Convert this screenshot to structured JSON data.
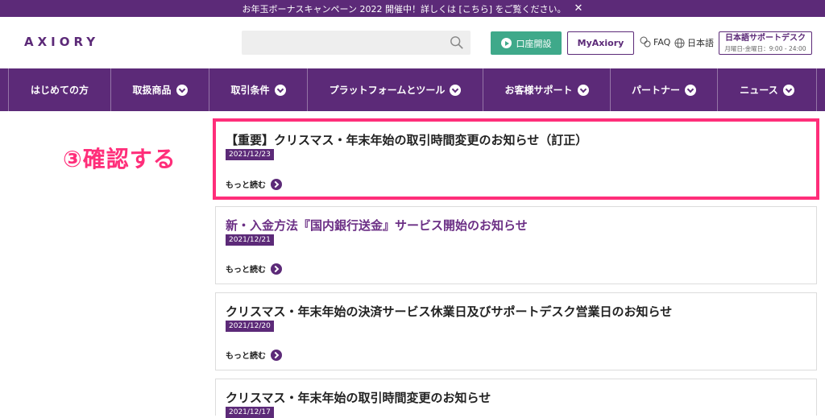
{
  "banner": {
    "text": "お年玉ボーナスキャンペーン 2022 開催中！詳しくは [こちら] をご覧ください。",
    "close": "✕"
  },
  "header": {
    "logo": "AXIORY",
    "search_placeholder": "",
    "open_account": "口座開設",
    "my_axiory": "MyAxiory",
    "faq": "FAQ",
    "language": "日本語",
    "support_title": "日本語サポートデスク",
    "support_hours": "月曜日-金曜日：9:00 - 24:00"
  },
  "nav": [
    {
      "label": "はじめての方",
      "chevron": false
    },
    {
      "label": "取扱商品",
      "chevron": true
    },
    {
      "label": "取引条件",
      "chevron": true
    },
    {
      "label": "プラットフォームとツール",
      "chevron": true
    },
    {
      "label": "お客様サポート",
      "chevron": true
    },
    {
      "label": "パートナー",
      "chevron": true
    },
    {
      "label": "ニュース",
      "chevron": true
    }
  ],
  "annotation": "③確認する",
  "news": [
    {
      "title": "【重要】クリスマス・年末年始の取引時間変更のお知らせ（訂正）",
      "date": "2021/12/23",
      "more": "もっと読む"
    },
    {
      "title": "新・入金方法『国内銀行送金』サービス開始のお知らせ",
      "date": "2021/12/21",
      "more": "もっと読む"
    },
    {
      "title": "クリスマス・年末年始の決済サービス休業日及びサポートデスク営業日のお知らせ",
      "date": "2021/12/20",
      "more": "もっと読む"
    },
    {
      "title": "クリスマス・年末年始の取引時間変更のお知らせ",
      "date": "2021/12/17",
      "more": ""
    }
  ],
  "colors": {
    "brand": "#5c2a78",
    "accent_green": "#3fa98a",
    "highlight": "#ff2e7a"
  }
}
